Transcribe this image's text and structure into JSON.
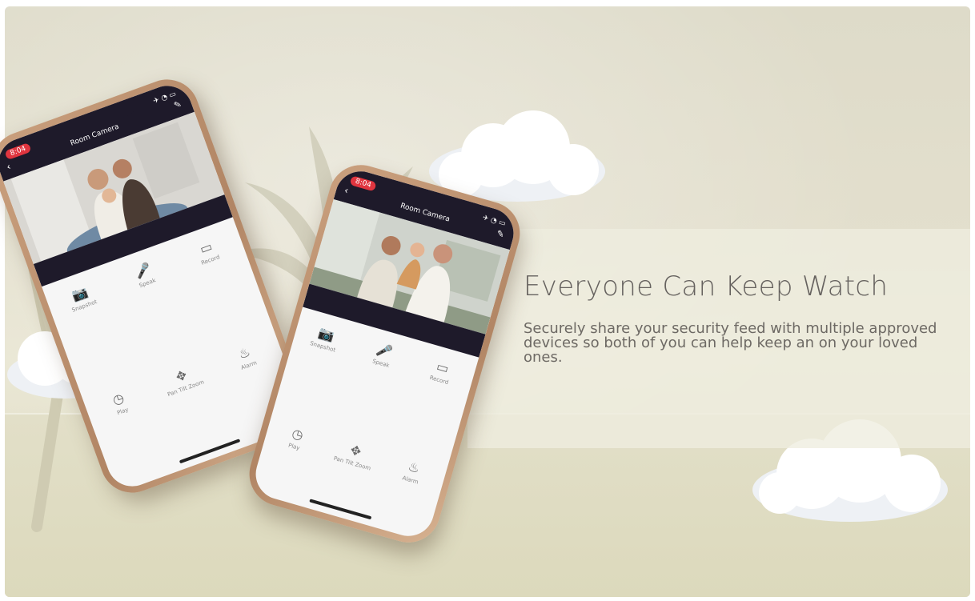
{
  "hero": {
    "heading": "Everyone Can Keep Watch",
    "body": "Securely share your security feed with multiple approved devices so both of you can help keep an on your loved ones."
  },
  "phone_left": {
    "time": "8:04",
    "title": "Room Camera",
    "controls": [
      {
        "icon": "camera-icon",
        "glyph": "📷",
        "label": "Snapshot"
      },
      {
        "icon": "microphone-icon",
        "glyph": "🎤",
        "label": "Speak"
      },
      {
        "icon": "video-icon",
        "glyph": "▭",
        "label": "Record"
      },
      {
        "icon": "playback-icon",
        "glyph": "◷",
        "label": "Play"
      },
      {
        "icon": "ptz-icon",
        "glyph": "✥",
        "label": "Pan Tilt Zoom"
      },
      {
        "icon": "alarm-icon",
        "glyph": "♨",
        "label": "Alarm"
      }
    ]
  },
  "phone_right": {
    "time": "8:04",
    "title": "Room Camera",
    "controls": [
      {
        "icon": "camera-icon",
        "glyph": "📷",
        "label": "Snapshot"
      },
      {
        "icon": "microphone-icon",
        "glyph": "🎤",
        "label": "Speak"
      },
      {
        "icon": "video-icon",
        "glyph": "▭",
        "label": "Record"
      },
      {
        "icon": "playback-icon",
        "glyph": "◷",
        "label": "Play"
      },
      {
        "icon": "ptz-icon",
        "glyph": "✥",
        "label": "Pan Tilt Zoom"
      },
      {
        "icon": "alarm-icon",
        "glyph": "♨",
        "label": "Alarm"
      }
    ]
  },
  "colors": {
    "accent_badge": "#e0353f",
    "header_dark": "#1e1a2a",
    "phone_frame": "#b18564",
    "heading_text": "#66625f"
  }
}
